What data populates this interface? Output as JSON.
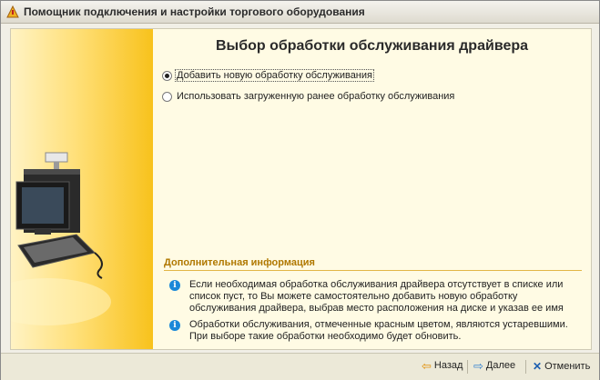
{
  "window": {
    "title": "Помощник подключения и настройки торгового оборудования"
  },
  "page": {
    "heading": "Выбор обработки обслуживания драйвера",
    "options": [
      {
        "label": "Добавить новую обработку обслуживания",
        "selected": true
      },
      {
        "label": "Использовать загруженную ранее обработку обслуживания",
        "selected": false
      }
    ]
  },
  "info": {
    "header": "Дополнительная информация",
    "items": [
      {
        "icon": "info-icon",
        "text": "Если необходимая обработка обслуживания драйвера отсутствует в списке или список пуст, то Вы можете самостоятельно добавить новую обработку обслуживания драйвера, выбрав место расположения на диске и указав ее имя"
      },
      {
        "icon": "info-icon",
        "text": "Обработки обслуживания, отмеченные красным цветом, являются устаревшими. При выборе такие обработки необходимо будет обновить."
      }
    ]
  },
  "buttons": {
    "back": "Назад",
    "next": "Далее",
    "cancel": "Отменить"
  },
  "colors": {
    "accent": "#b07800",
    "info": "#1a88d8",
    "panel": "#fffbe4"
  }
}
